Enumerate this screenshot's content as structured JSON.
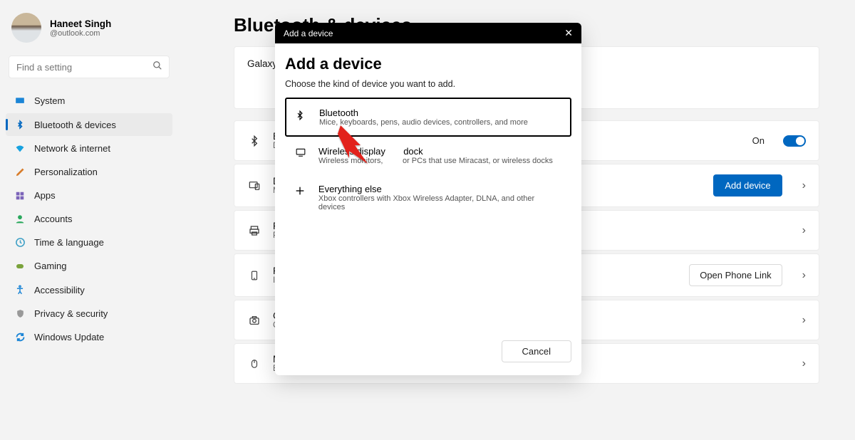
{
  "user": {
    "name": "Haneet Singh",
    "email": "@outlook.com"
  },
  "search": {
    "placeholder": "Find a setting"
  },
  "nav": [
    {
      "id": "system",
      "label": "System",
      "color": "#1b85d6"
    },
    {
      "id": "bluetooth",
      "label": "Bluetooth & devices",
      "color": "#0067c0",
      "active": true
    },
    {
      "id": "network",
      "label": "Network & internet",
      "color": "#17a2e0"
    },
    {
      "id": "personalization",
      "label": "Personalization",
      "color": "#d87c2a"
    },
    {
      "id": "apps",
      "label": "Apps",
      "color": "#7b63b9"
    },
    {
      "id": "accounts",
      "label": "Accounts",
      "color": "#2aa85d"
    },
    {
      "id": "time",
      "label": "Time & language",
      "color": "#3fa0c6"
    },
    {
      "id": "gaming",
      "label": "Gaming",
      "color": "#7aa23b"
    },
    {
      "id": "accessibility",
      "label": "Accessibility",
      "color": "#1b85d6"
    },
    {
      "id": "privacy",
      "label": "Privacy & security",
      "color": "#888"
    },
    {
      "id": "update",
      "label": "Windows Update",
      "color": "#1b85d6"
    }
  ],
  "page": {
    "title": "Bluetooth & devices"
  },
  "galaxy": {
    "label": "Galaxy"
  },
  "cards": {
    "bluetooth": {
      "title": "Blu",
      "sub": "Dis",
      "on": "On"
    },
    "devices": {
      "title": "De",
      "sub": "Mo",
      "button": "Add device"
    },
    "printers": {
      "title": "Pri",
      "sub": "Pre"
    },
    "phone": {
      "title": "Ph",
      "sub": "Ins",
      "button": "Open Phone Link"
    },
    "cameras": {
      "title": "Cameras",
      "sub": "Connected cameras, default image settings"
    },
    "mouse": {
      "title": "Mouse",
      "sub": "Buttons, mouse pointer speed, scrolling"
    }
  },
  "dialog": {
    "windowTitle": "Add a device",
    "heading": "Add a device",
    "sub": "Choose the kind of device you want to add.",
    "options": [
      {
        "title": "Bluetooth",
        "desc": "Mice, keyboards, pens, audio devices, controllers, and more",
        "selected": true
      },
      {
        "title": "Wireless display       dock",
        "desc": "Wireless monitors,         or PCs that use Miracast, or wireless docks"
      },
      {
        "title": "Everything else",
        "desc": "Xbox controllers with Xbox Wireless Adapter, DLNA, and other devices"
      }
    ],
    "cancel": "Cancel"
  }
}
